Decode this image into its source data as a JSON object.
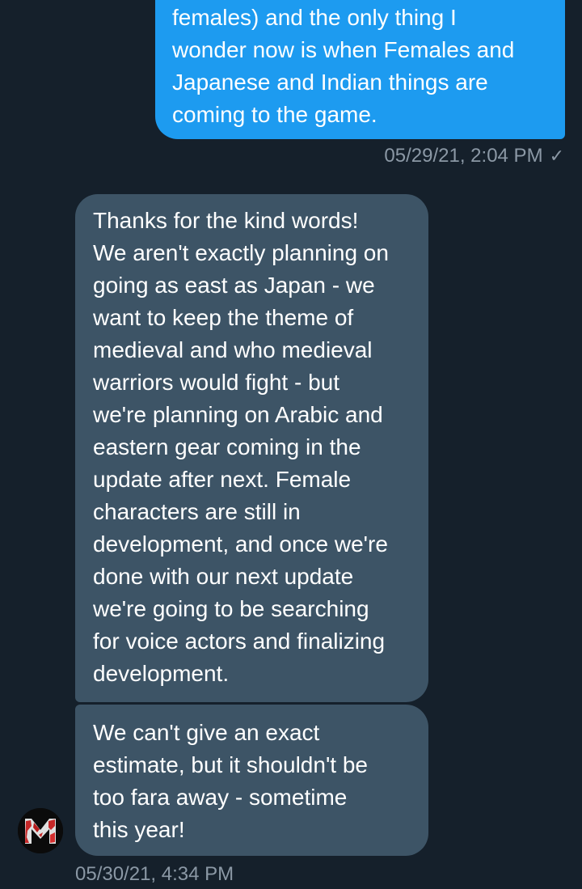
{
  "conversation": {
    "sent_message": {
      "text": "females) and the only thing I\nwonder now is when Females and\nJapanese and Indian things are\ncoming to the game.",
      "timestamp": "05/29/21, 2:04 PM",
      "status_icon": "checkmark-icon",
      "status_glyph": "✓",
      "bubble_color": "#1d9bf0"
    },
    "received_messages": [
      {
        "text": "Thanks for the kind words!\nWe aren't exactly planning on\ngoing as east as Japan - we\nwant to keep the theme of\nmedieval and who medieval\nwarriors would fight - but\nwe're planning on Arabic and\neastern gear coming in the\nupdate after next. Female\ncharacters are still in\ndevelopment, and once we're\ndone with our next update\nwe're going to be searching\nfor voice actors and finalizing\ndevelopment."
      },
      {
        "text": "We can't give an exact\nestimate, but it shouldn't be\ntoo fara away - sometime\nthis year!"
      }
    ],
    "received_timestamp": "05/30/21, 4:34 PM",
    "received_bubble_color": "#3d5466",
    "sender_avatar": {
      "icon": "m-logo-avatar-icon",
      "letter": "M",
      "accent_color": "#c62828"
    }
  },
  "theme": {
    "background": "#15202b",
    "muted_text": "#8b98a5"
  }
}
